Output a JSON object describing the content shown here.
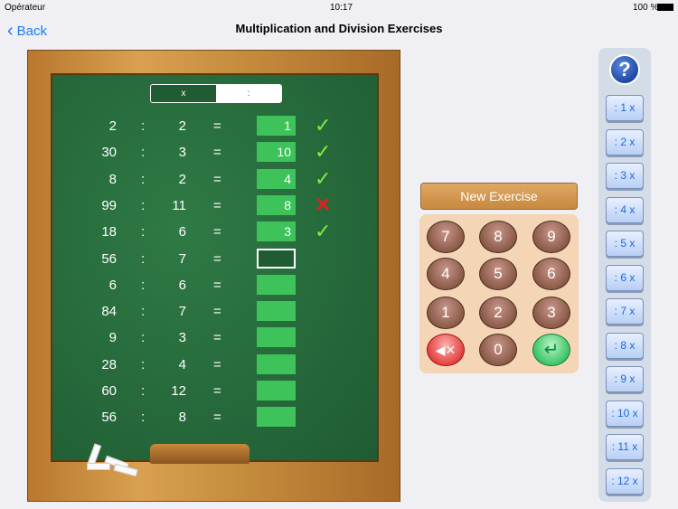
{
  "status": {
    "carrier": "Opérateur",
    "time": "10:17",
    "battery": "100 %"
  },
  "nav": {
    "back": "Back",
    "title": "Multiplication and Division Exercises"
  },
  "toggle": {
    "multiply": "x",
    "divide": ":"
  },
  "rows": [
    {
      "a": "2",
      "op": ":",
      "b": "2",
      "eq": "=",
      "answer": "1",
      "result": "correct"
    },
    {
      "a": "30",
      "op": ":",
      "b": "3",
      "eq": "=",
      "answer": "10",
      "result": "correct"
    },
    {
      "a": "8",
      "op": ":",
      "b": "2",
      "eq": "=",
      "answer": "4",
      "result": "correct"
    },
    {
      "a": "99",
      "op": ":",
      "b": "11",
      "eq": "=",
      "answer": "8",
      "result": "wrong"
    },
    {
      "a": "18",
      "op": ":",
      "b": "6",
      "eq": "=",
      "answer": "3",
      "result": "correct"
    },
    {
      "a": "56",
      "op": ":",
      "b": "7",
      "eq": "=",
      "answer": "",
      "result": "active"
    },
    {
      "a": "6",
      "op": ":",
      "b": "6",
      "eq": "=",
      "answer": "",
      "result": ""
    },
    {
      "a": "84",
      "op": ":",
      "b": "7",
      "eq": "=",
      "answer": "",
      "result": ""
    },
    {
      "a": "9",
      "op": ":",
      "b": "3",
      "eq": "=",
      "answer": "",
      "result": ""
    },
    {
      "a": "28",
      "op": ":",
      "b": "4",
      "eq": "=",
      "answer": "",
      "result": ""
    },
    {
      "a": "60",
      "op": ":",
      "b": "12",
      "eq": "=",
      "answer": "",
      "result": ""
    },
    {
      "a": "56",
      "op": ":",
      "b": "8",
      "eq": "=",
      "answer": "",
      "result": ""
    }
  ],
  "new_exercise": "New Exercise",
  "keys": [
    "7",
    "8",
    "9",
    "4",
    "5",
    "6",
    "1",
    "2",
    "3",
    "delete",
    "0",
    "enter"
  ],
  "key_zero": "0",
  "tables": [
    ": 1 x",
    ": 2 x",
    ": 3 x",
    ": 4 x",
    ": 5 x",
    ": 6 x",
    ": 7 x",
    ": 8 x",
    ": 9 x",
    ": 10 x",
    ": 11 x",
    ": 12 x"
  ],
  "help": "?"
}
